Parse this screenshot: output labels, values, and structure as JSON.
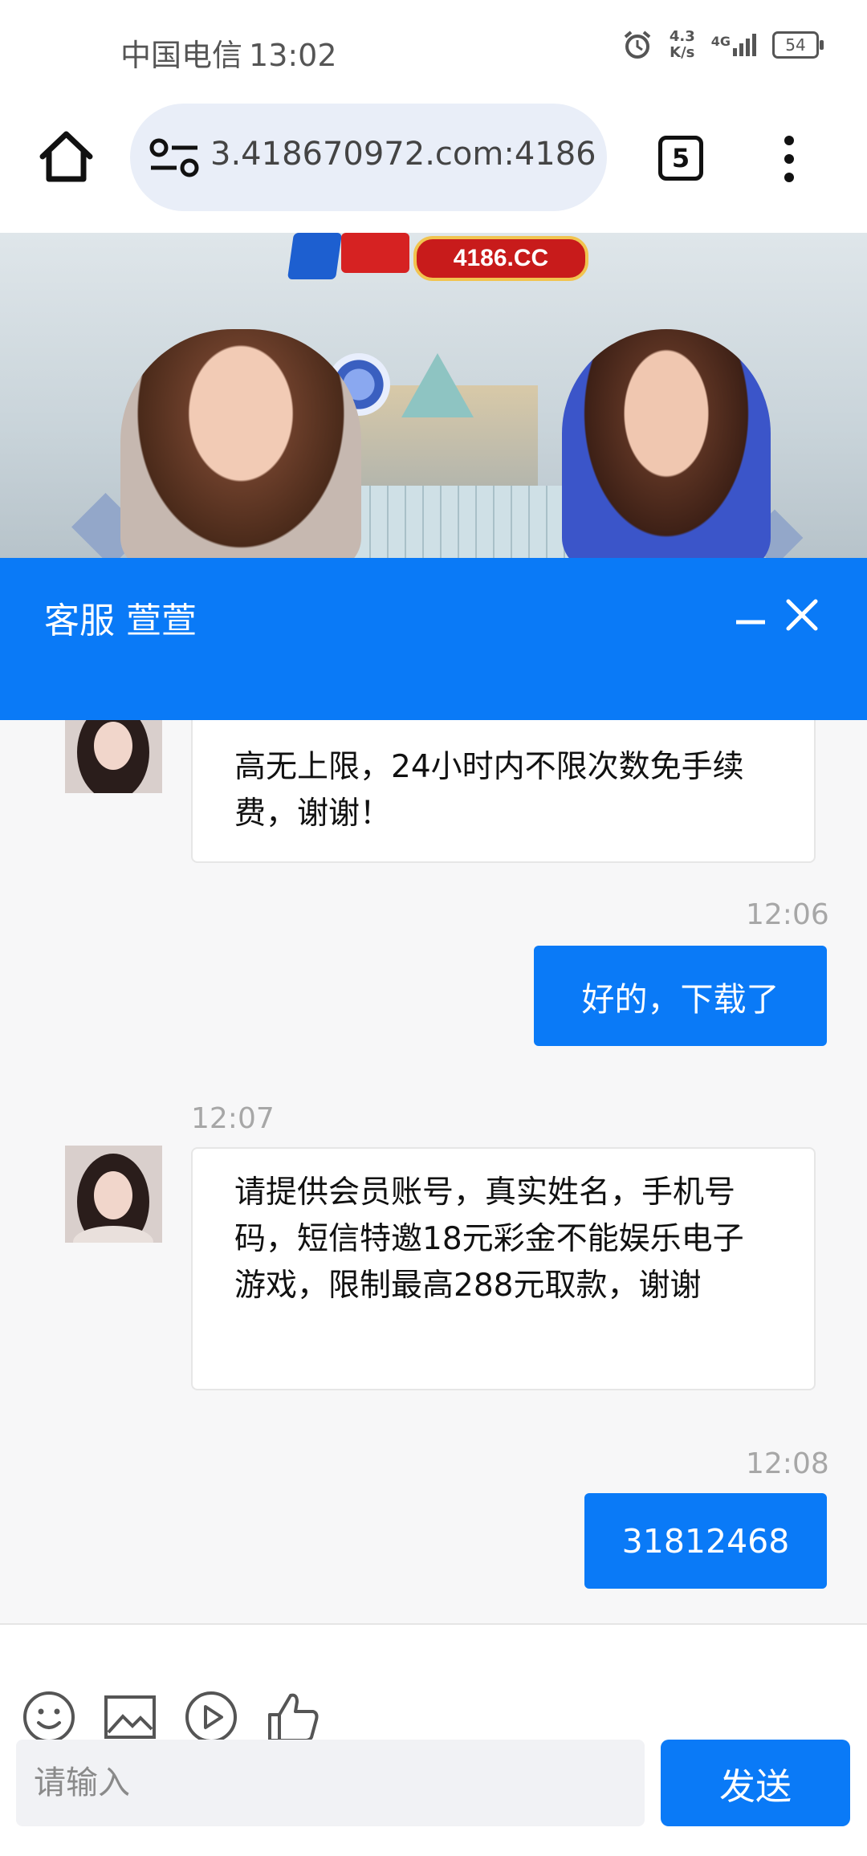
{
  "status_bar": {
    "carrier": "中国电信",
    "time": "13:02",
    "net_speed_value": "4.3",
    "net_speed_unit": "K/s",
    "network": "4G",
    "battery": "54",
    "icons": [
      "alarm-icon",
      "signal-icon",
      "battery-icon"
    ]
  },
  "browser": {
    "url": "3.418670972.com:4186",
    "tab_count": "5",
    "icons": [
      "home-icon",
      "site-info-icon",
      "tabs-icon",
      "more-menu-icon"
    ]
  },
  "banner": {
    "badge": "4186.CC"
  },
  "chat": {
    "header_title": "客服",
    "agent_name": "萱萱",
    "accent_color": "#0a7af7",
    "messages": [
      {
        "from": "agent",
        "time": "",
        "text": "高无上限，24小时内不限次数免手续费，谢谢！"
      },
      {
        "from": "user",
        "time": "12:06",
        "text": "好的，下载了"
      },
      {
        "from": "agent",
        "time": "12:07",
        "text": "请提供会员账号，真实姓名，手机号码，短信特邀18元彩金不能娱乐电子游戏，限制最高288元取款，谢谢"
      },
      {
        "from": "user",
        "time": "12:08",
        "text": "31812468"
      }
    ]
  },
  "composer": {
    "placeholder": "请输入",
    "send_label": "发送",
    "tools": [
      "emoji-icon",
      "image-icon",
      "video-icon",
      "thumbs-up-icon"
    ]
  }
}
